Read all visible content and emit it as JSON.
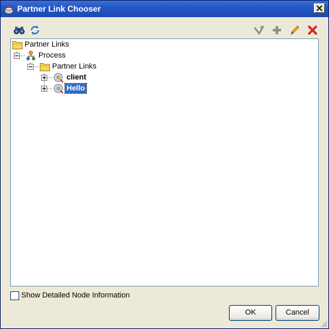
{
  "window": {
    "title": "Partner Link Chooser"
  },
  "toolbar": {
    "left_icons": [
      "binoculars-icon",
      "refresh-icon"
    ],
    "right_icons": [
      "filter-icon",
      "add-icon",
      "edit-icon",
      "delete-icon"
    ]
  },
  "tree": {
    "root_label": "Partner Links",
    "process_label": "Process",
    "partner_links_label": "Partner Links",
    "children": [
      "client",
      "Hello"
    ],
    "selected": "Hello"
  },
  "footer": {
    "checkbox_label": "Show Detailed Node Information",
    "checkbox_checked": false,
    "ok_label": "OK",
    "cancel_label": "Cancel"
  },
  "colors": {
    "title_bar": "#2457c8",
    "selection": "#316ac5",
    "delete_red": "#d8241c"
  }
}
